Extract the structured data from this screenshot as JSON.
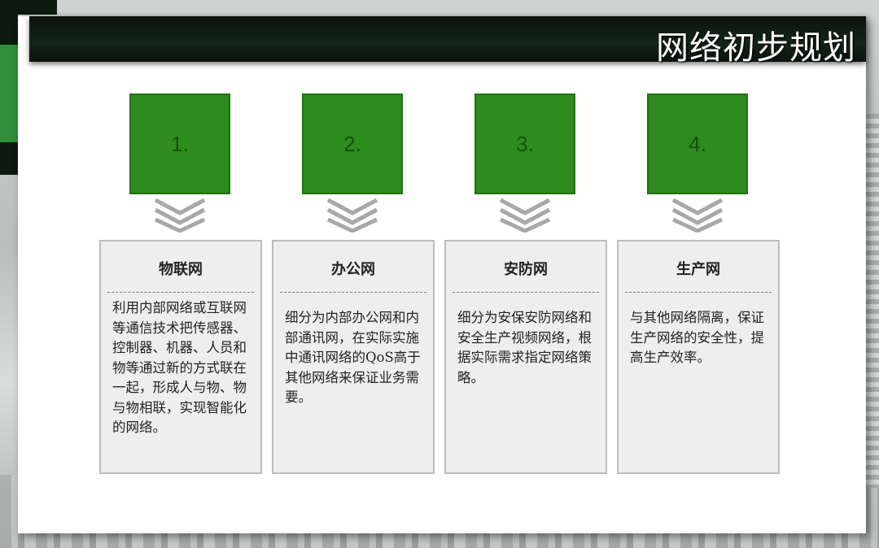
{
  "title": "网络初步规划",
  "colors": {
    "accent_green": "#2e8b1e",
    "title_bar": "#0b140d",
    "box_bg": "#eeeeee"
  },
  "steps": [
    {
      "number": "1.",
      "heading": "物联网",
      "body": "利用内部网络或互联网等通信技术把传感器、控制器、机器、人员和物等通过新的方式联在一起，形成人与物、物与物相联，实现智能化的网络。"
    },
    {
      "number": "2.",
      "heading": "办公网",
      "body": "细分为内部办公网和内部通讯网，在实际实施中通讯网络的QoS高于其他网络来保证业务需要。"
    },
    {
      "number": "3.",
      "heading": "安防网",
      "body": "细分为安保安防网络和安全生产视频网络，根据实际需求指定网络策略。"
    },
    {
      "number": "4.",
      "heading": "生产网",
      "body": "与其他网络隔离，保证生产网络的安全性，提高生产效率。"
    }
  ]
}
